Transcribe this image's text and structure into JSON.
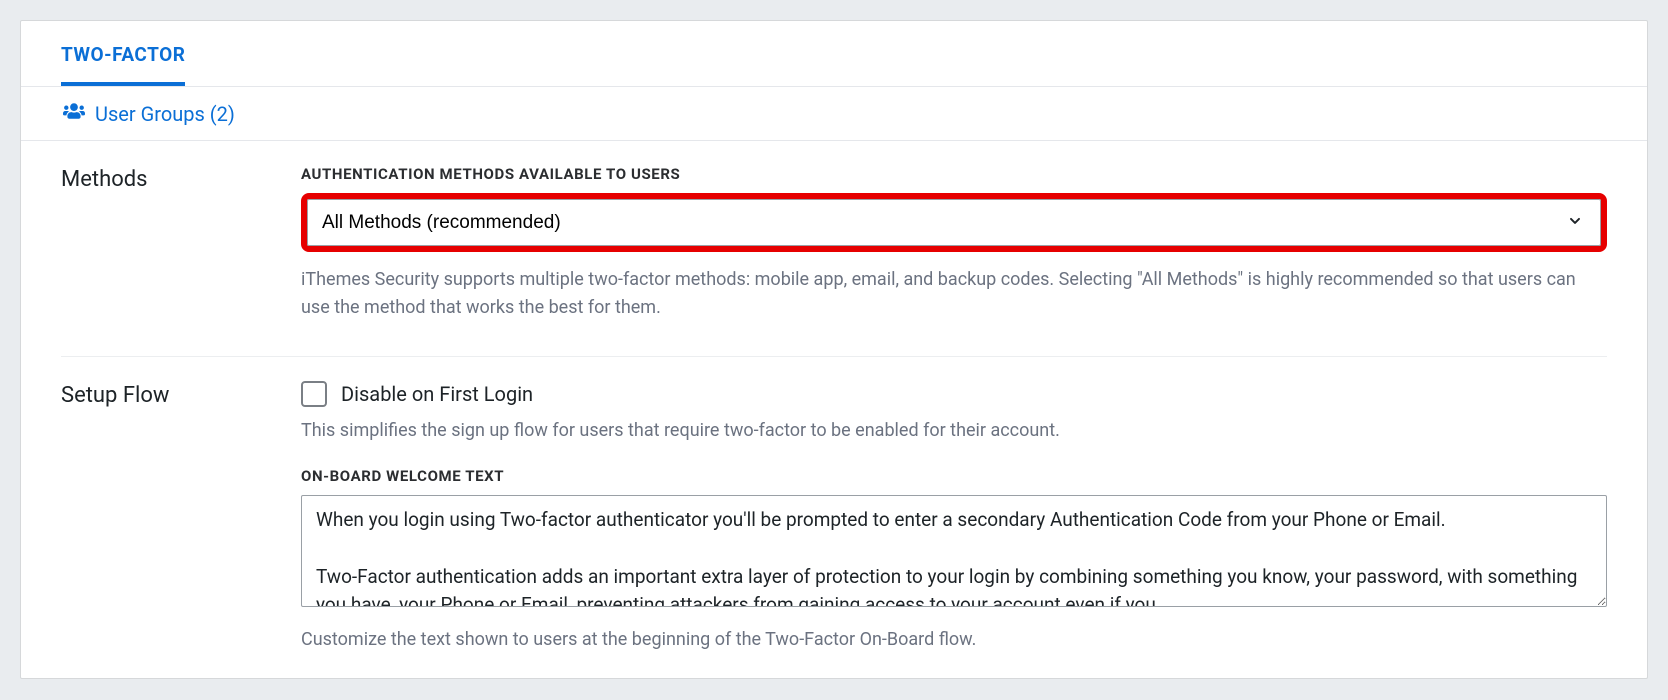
{
  "tab": {
    "label": "Two-Factor"
  },
  "subnav": {
    "userGroups": "User Groups (2)"
  },
  "methods": {
    "sectionTitle": "Methods",
    "fieldTitle": "Authentication Methods Available to Users",
    "selected": "All Methods (recommended)",
    "help": "iThemes Security supports multiple two-factor methods: mobile app, email, and backup codes. Selecting \"All Methods\" is highly recommended so that users can use the method that works the best for them."
  },
  "setupFlow": {
    "sectionTitle": "Setup Flow",
    "disableCheckbox": {
      "label": "Disable on First Login",
      "checked": false
    },
    "disableHelp": "This simplifies the sign up flow for users that require two-factor to be enabled for their account.",
    "welcomeTitle": "On-Board Welcome Text",
    "welcomeText": "When you login using Two-factor authenticator you'll be prompted to enter a secondary Authentication Code from your Phone or Email.\n\nTwo-Factor authentication adds an important extra layer of protection to your login by combining something you know, your password, with something you have, your Phone or Email, preventing attackers from gaining access to your account even if you",
    "welcomeHelp": "Customize the text shown to users at the beginning of the Two-Factor On-Board flow."
  }
}
